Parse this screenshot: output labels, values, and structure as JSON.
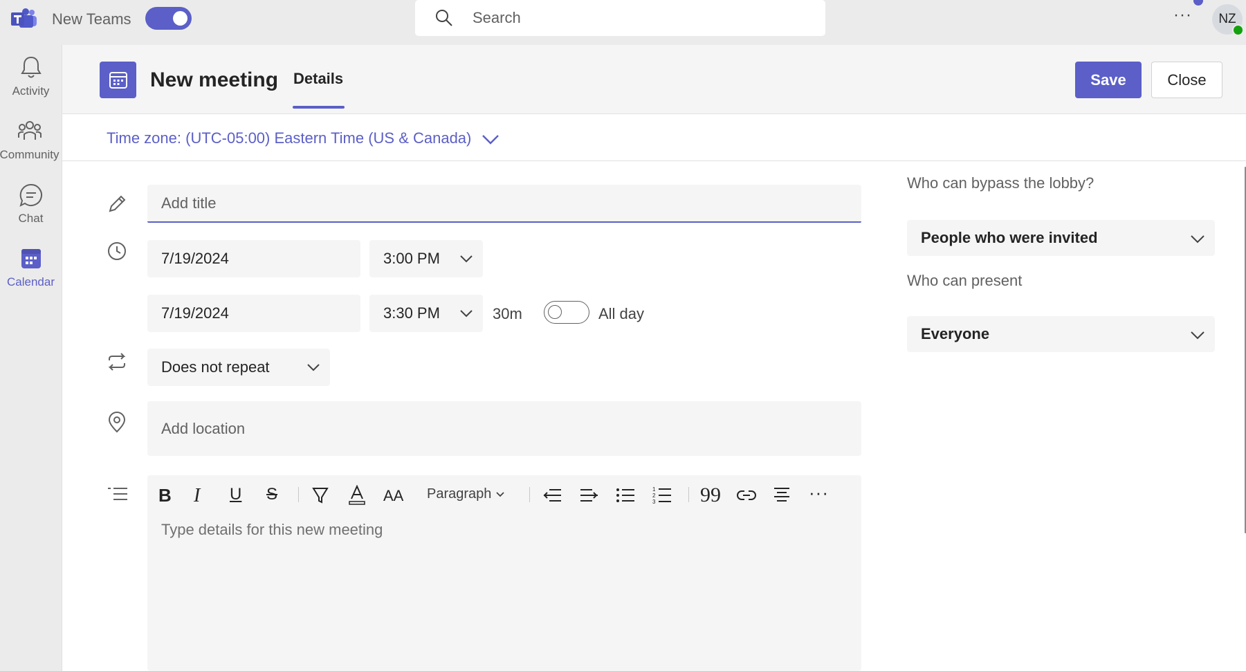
{
  "app": {
    "name": "New Teams",
    "toggle_state": "on"
  },
  "search": {
    "placeholder": "Search"
  },
  "user": {
    "initials": "NZ",
    "presence": "available"
  },
  "rail": [
    {
      "label": "Activity",
      "icon": "bell-icon"
    },
    {
      "label": "Community",
      "icon": "people-icon"
    },
    {
      "label": "Chat",
      "icon": "chat-icon"
    },
    {
      "label": "Calendar",
      "icon": "calendar-icon",
      "active": true
    }
  ],
  "header": {
    "title": "New meeting",
    "tab": "Details",
    "save_label": "Save",
    "close_label": "Close"
  },
  "timezone": {
    "label": "Time zone: (UTC-05:00) Eastern Time (US & Canada)"
  },
  "form": {
    "title_placeholder": "Add title",
    "start_date": "7/19/2024",
    "start_time": "3:00 PM",
    "end_date": "7/19/2024",
    "end_time": "3:30 PM",
    "duration": "30m",
    "allday_label": "All day",
    "allday_on": false,
    "repeat": "Does not repeat",
    "location_placeholder": "Add location",
    "details_placeholder": "Type details for this new meeting",
    "paragraph_style": "Paragraph"
  },
  "options": {
    "lobby_label": "Who can bypass the lobby?",
    "lobby_value": "People who were invited",
    "present_label": "Who can present",
    "present_value": "Everyone"
  },
  "colors": {
    "accent": "#5b5fc7",
    "presence": "#13a10e"
  }
}
